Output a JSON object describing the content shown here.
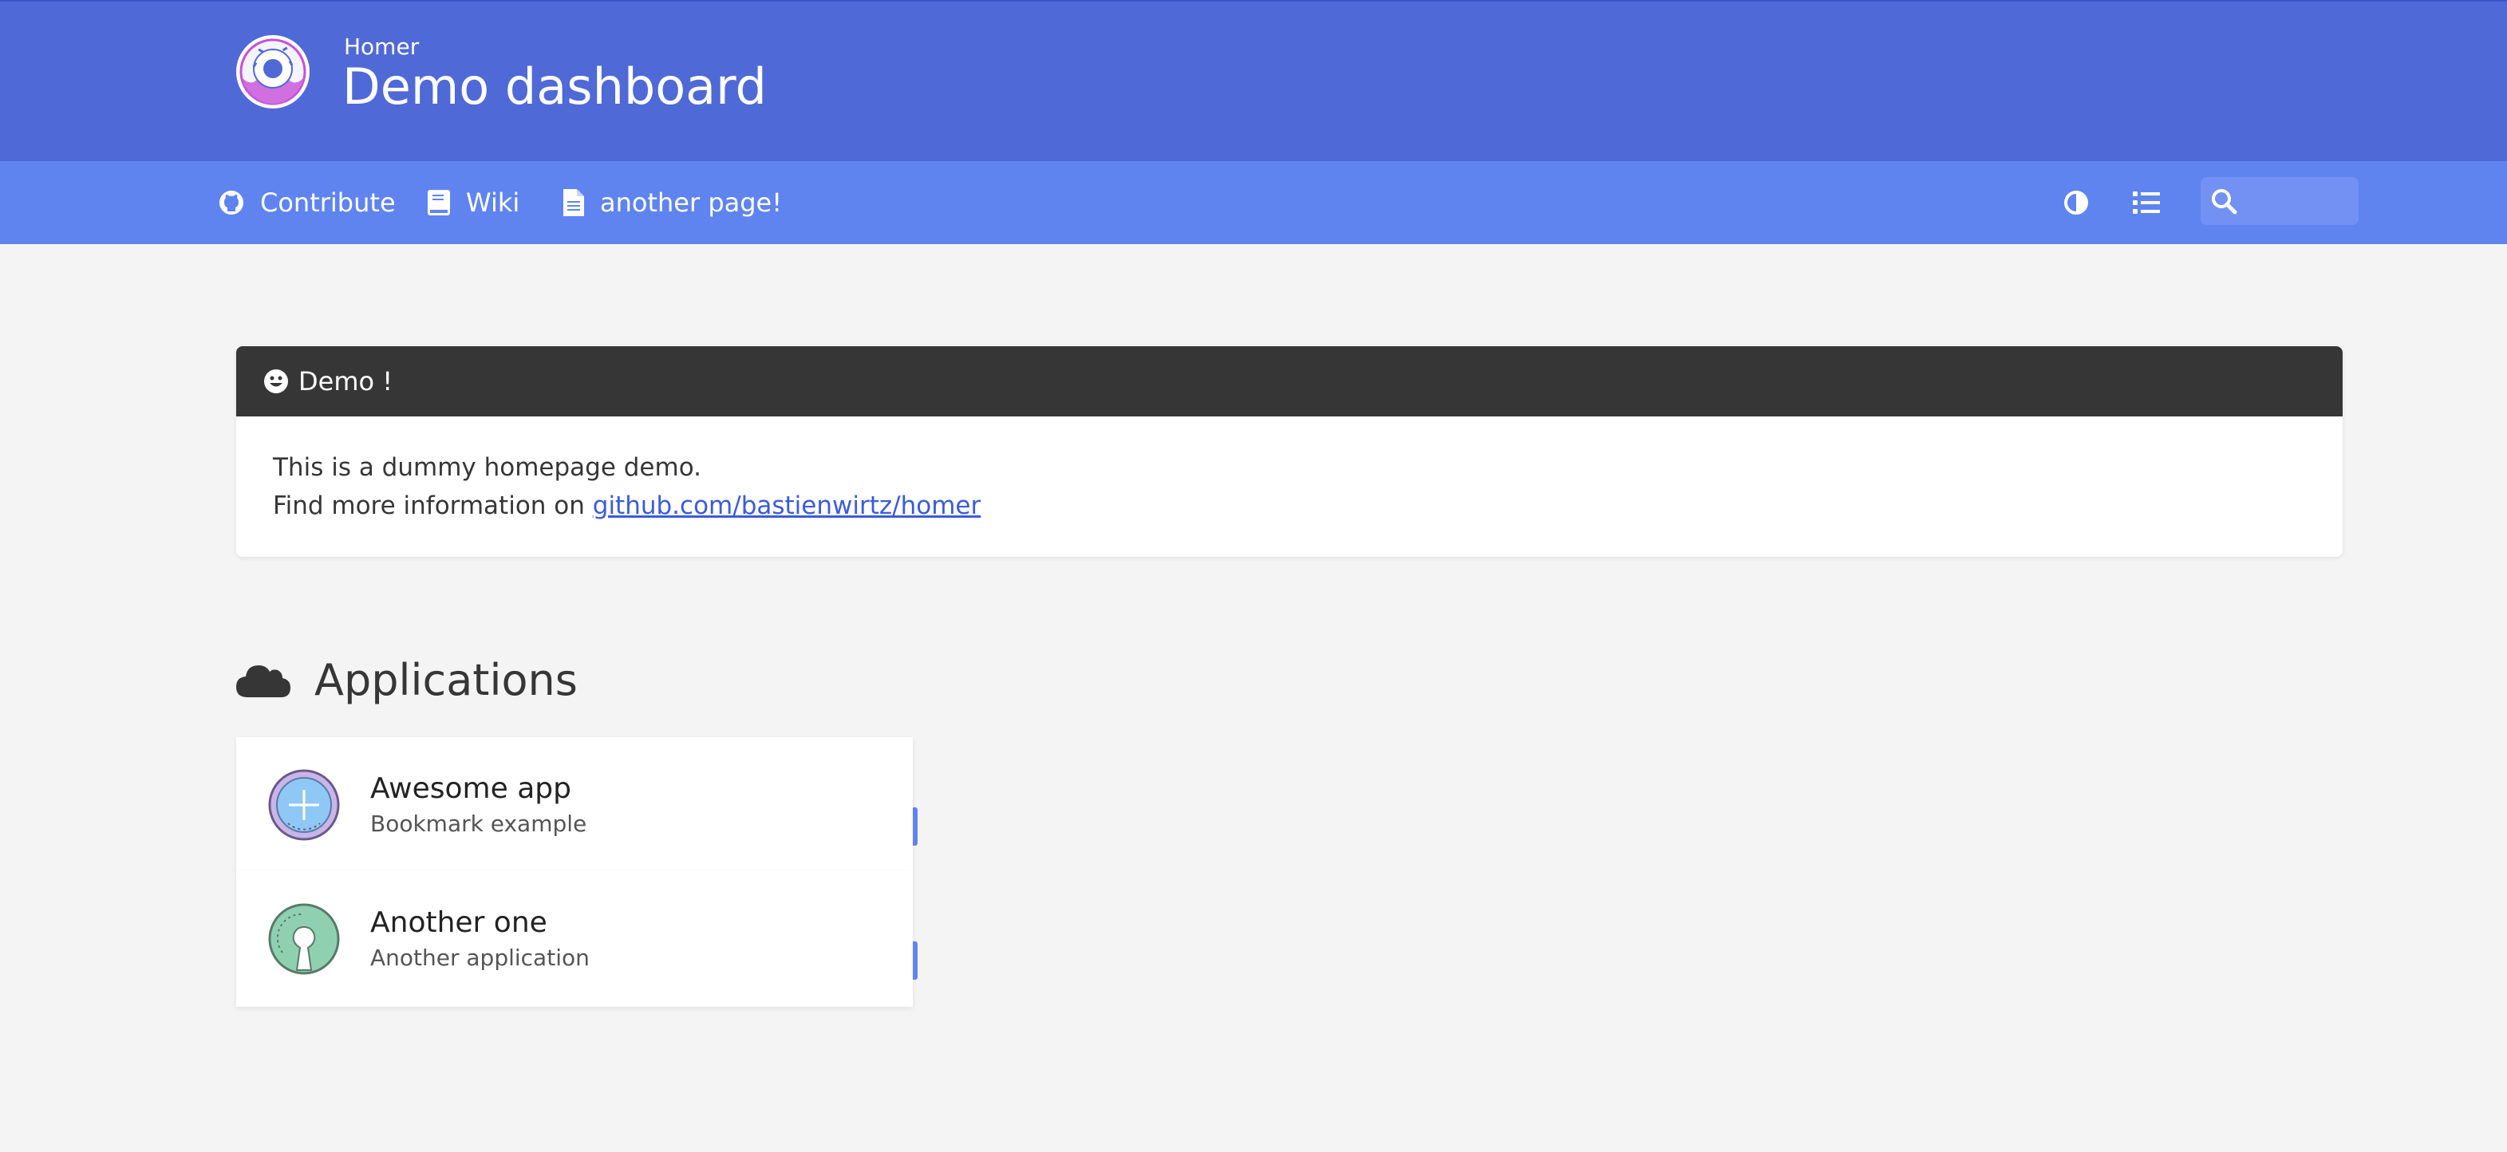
{
  "header": {
    "subtitle": "Homer",
    "title": "Demo dashboard",
    "logo_icon": "donut-logo"
  },
  "nav": {
    "links": [
      {
        "label": "Contribute",
        "icon": "github-icon"
      },
      {
        "label": "Wiki",
        "icon": "book-icon"
      },
      {
        "label": "another page!",
        "icon": "file-icon"
      }
    ],
    "dark_mode_icon": "contrast-icon",
    "layout_icon": "list-icon",
    "search_placeholder": ""
  },
  "message": {
    "title": "Demo !",
    "icon": "smile-icon",
    "line1": "This is a dummy homepage demo.",
    "line2_prefix": "Find more information on",
    "link_text": "github.com/bastienwirtz/homer"
  },
  "group": {
    "title": "Applications",
    "icon": "cloud-icon",
    "items": [
      {
        "name": "Awesome app",
        "subtitle": "Bookmark example",
        "icon": "plus-badge-icon"
      },
      {
        "name": "Another one",
        "subtitle": "Another application",
        "icon": "open-source-icon"
      }
    ]
  },
  "colors": {
    "header": "#4f69d7",
    "navbar": "#5f84f0",
    "message_header": "#363636",
    "background": "#f4f4f4",
    "link": "#3b5bdb"
  }
}
